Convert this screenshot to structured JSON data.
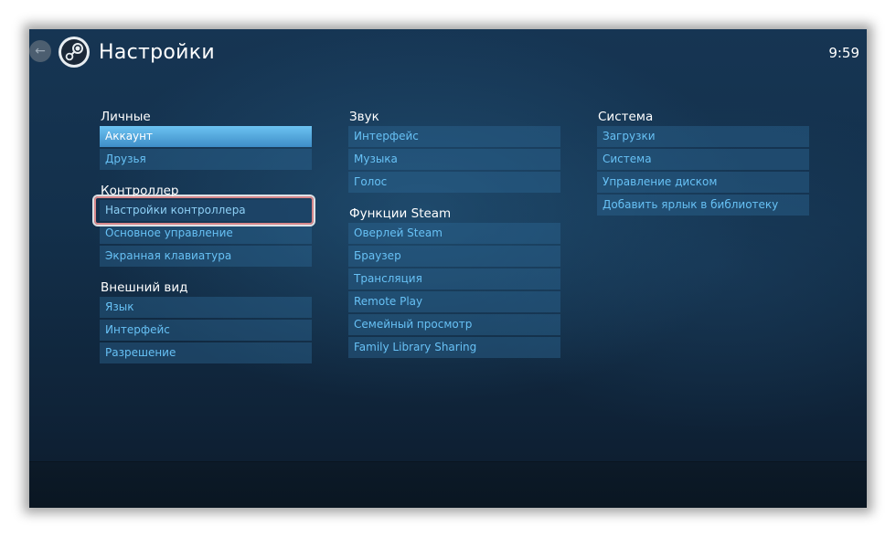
{
  "header": {
    "title": "Настройки",
    "clock": "9:59",
    "back_icon": "back-arrow-icon",
    "logo_icon": "steam-logo-icon"
  },
  "columns": [
    {
      "sections": [
        {
          "title": "Личные",
          "items": [
            "Аккаунт",
            "Друзья"
          ]
        },
        {
          "title": "Контроллер",
          "items": [
            "Настройки контроллера",
            "Основное управление",
            "Экранная клавиатура"
          ]
        },
        {
          "title": "Внешний вид",
          "items": [
            "Язык",
            "Интерфейс",
            "Разрешение"
          ]
        }
      ]
    },
    {
      "sections": [
        {
          "title": "Звук",
          "items": [
            "Интерфейс",
            "Музыка",
            "Голос"
          ]
        },
        {
          "title": "Функции Steam",
          "items": [
            "Оверлей Steam",
            "Браузер",
            "Трансляция",
            "Remote Play",
            "Семейный просмотр",
            "Family Library Sharing"
          ]
        }
      ]
    },
    {
      "sections": [
        {
          "title": "Система",
          "items": [
            "Загрузки",
            "Система",
            "Управление диском",
            "Добавить ярлык в библиотеку"
          ]
        }
      ]
    }
  ],
  "state": {
    "active_item": "Аккаунт",
    "focused_item": "Настройки контроллера"
  },
  "colors": {
    "accent": "#67c1f5",
    "active_bg": "#4f9fd6",
    "focus_ring": "#d7888b"
  }
}
